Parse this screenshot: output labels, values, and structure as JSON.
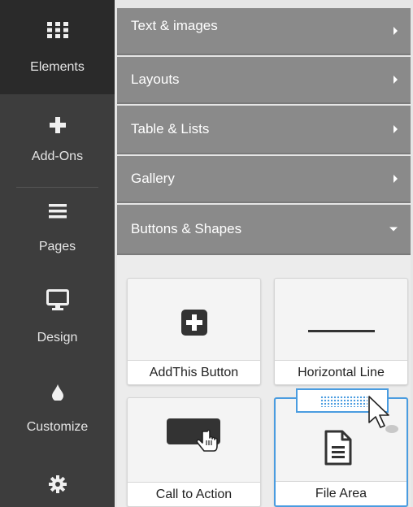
{
  "nav": {
    "items": [
      {
        "label": "Elements",
        "icon": "grid-icon",
        "active": true
      },
      {
        "label": "Add-Ons",
        "icon": "plus-icon",
        "active": false
      },
      {
        "label": "Pages",
        "icon": "hamburger-icon",
        "active": false
      },
      {
        "label": "Design",
        "icon": "monitor-icon",
        "active": false
      },
      {
        "label": "Customize",
        "icon": "drop-icon",
        "active": false
      },
      {
        "label": "",
        "icon": "gear-icon",
        "active": false
      }
    ]
  },
  "accordion": {
    "sections": [
      {
        "label": "Text & images",
        "expanded": false
      },
      {
        "label": "Layouts",
        "expanded": false
      },
      {
        "label": "Table & Lists",
        "expanded": false
      },
      {
        "label": "Gallery",
        "expanded": false
      },
      {
        "label": "Buttons & Shapes",
        "expanded": true
      }
    ]
  },
  "tiles": [
    {
      "label": "AddThis Button",
      "icon": "plus-square-icon"
    },
    {
      "label": "Horizontal Line",
      "icon": "horizontal-line-icon"
    },
    {
      "label": "Call to Action",
      "icon": "cta-button-icon"
    },
    {
      "label": "File Area",
      "icon": "document-icon"
    }
  ],
  "colors": {
    "nav_bg": "#3d3d3d",
    "nav_active_bg": "#2a2a2a",
    "header_bg": "#8a8a8a",
    "accent": "#4a9ce0"
  }
}
